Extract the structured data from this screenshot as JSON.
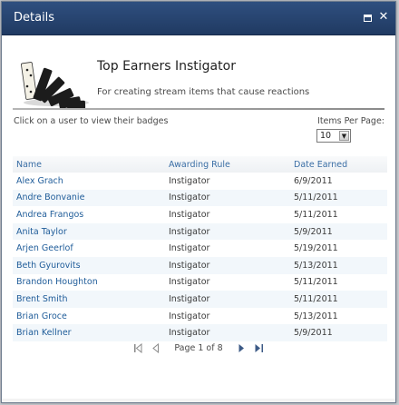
{
  "dialog": {
    "title": "Details",
    "maximize_icon": "maximize-icon",
    "close_icon": "close-icon",
    "close_glyph": "✕"
  },
  "badge": {
    "title": "Top Earners Instigator",
    "description": "For creating stream items that cause reactions",
    "image_icon": "dominoes-icon"
  },
  "controls": {
    "hint": "Click on a user to view their badges",
    "items_per_page_label": "Items Per Page:",
    "items_per_page_value": "10"
  },
  "table": {
    "columns": [
      "Name",
      "Awarding Rule",
      "Date Earned"
    ],
    "rows": [
      {
        "name": "Alex Grach",
        "rule": "Instigator",
        "date": "6/9/2011"
      },
      {
        "name": "Andre Bonvanie",
        "rule": "Instigator",
        "date": "5/11/2011"
      },
      {
        "name": "Andrea Frangos",
        "rule": "Instigator",
        "date": "5/11/2011"
      },
      {
        "name": "Anita Taylor",
        "rule": "Instigator",
        "date": "5/9/2011"
      },
      {
        "name": "Arjen Geerlof",
        "rule": "Instigator",
        "date": "5/19/2011"
      },
      {
        "name": "Beth Gyurovits",
        "rule": "Instigator",
        "date": "5/13/2011"
      },
      {
        "name": "Brandon Houghton",
        "rule": "Instigator",
        "date": "5/11/2011"
      },
      {
        "name": "Brent Smith",
        "rule": "Instigator",
        "date": "5/11/2011"
      },
      {
        "name": "Brian Groce",
        "rule": "Instigator",
        "date": "5/13/2011"
      },
      {
        "name": "Brian Kellner",
        "rule": "Instigator",
        "date": "5/9/2011"
      }
    ]
  },
  "pager": {
    "text": "Page 1 of 8",
    "first_icon": "first-page-icon",
    "prev_icon": "previous-page-icon",
    "next_icon": "next-page-icon",
    "last_icon": "last-page-icon"
  },
  "colors": {
    "titlebar": "#203a62",
    "link": "#1f5c99",
    "header_text": "#3a6ea5",
    "row_alt": "#f2f7fb"
  }
}
